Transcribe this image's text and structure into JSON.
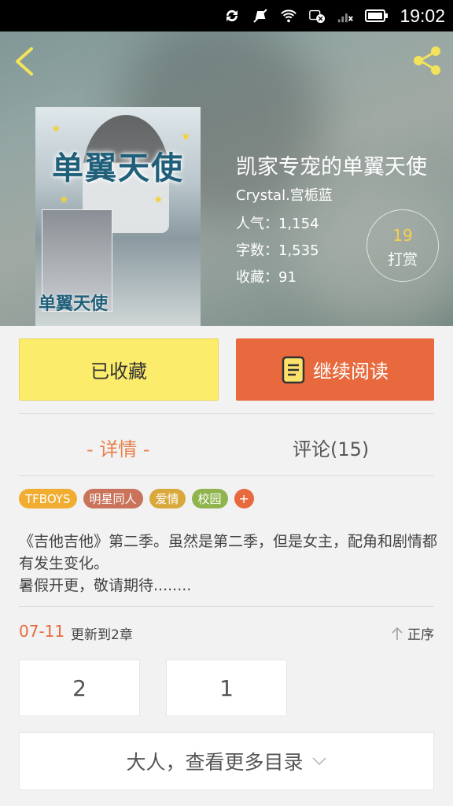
{
  "status_bar": {
    "time": "19:02"
  },
  "book": {
    "title": "凯家专宠的单翼天使",
    "author": "Crystal.宫栀蓝",
    "stats": [
      {
        "label": "人气：1,154"
      },
      {
        "label": "字数：1,535"
      },
      {
        "label": "收藏：91"
      }
    ],
    "tip_count": "19",
    "tip_label": "打赏",
    "cover_title": "单翼天使",
    "cover_title_small": "单翼天使"
  },
  "actions": {
    "favorited_label": "已收藏",
    "continue_label": "继续阅读"
  },
  "tabs": [
    {
      "label": "- 详情 -"
    },
    {
      "label": "评论(15)"
    }
  ],
  "tags": [
    {
      "label": "TFBOYS",
      "color": "#f1ad32"
    },
    {
      "label": "明星同人",
      "color": "#c8735a"
    },
    {
      "label": "爱情",
      "color": "#d9a83a"
    },
    {
      "label": "校园",
      "color": "#8fb44e"
    },
    {
      "label": "+",
      "color": "#e8693d"
    }
  ],
  "description": "《吉他吉他》第二季。虽然是第二季，但是女主，配角和剧情都有发生变化。\n暑假开更，敬请期待........",
  "update": {
    "date": "07-11",
    "text": "更新到2章",
    "sort_label": "正序"
  },
  "chapters": [
    {
      "label": "2"
    },
    {
      "label": "1"
    }
  ],
  "more_label": "大人，查看更多目录",
  "colors": {
    "accent": "#e8693d",
    "fav_button": "#fcec6b",
    "tip_count": "#f5d04a"
  }
}
